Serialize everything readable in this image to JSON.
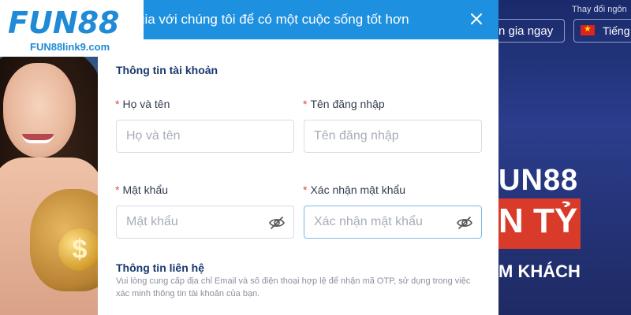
{
  "logo": {
    "brand": "FUN88",
    "domain": "FUN88link9.com"
  },
  "background": {
    "language_label": "Thay đổi ngôn",
    "join_button": "n gia ngay",
    "language_button": "Tiếng",
    "promo_brand": "UN88",
    "promo_amount": "N TỶ",
    "promo_sub": "M KHÁCH",
    "coin_symbol": "$"
  },
  "modal": {
    "title": "gia với chúng tôi để có một cuộc sống tốt hơn",
    "close_icon": "close-icon",
    "account_section": "Thông tin tài khoản",
    "contact_section": "Thông tin liên hệ",
    "contact_description": "Vui lòng cung cấp địa chỉ Email và số điện thoại hợp lệ để nhận mã OTP, sử dụng trong việc xác minh thông tin tài khoản của bạn.",
    "required_mark": "*",
    "fields": {
      "full_name": {
        "label": "Họ và tên",
        "placeholder": "Họ và tên"
      },
      "username": {
        "label": "Tên đăng nhập",
        "placeholder": "Tên đăng nhập"
      },
      "password": {
        "label": "Mật khẩu",
        "placeholder": "Mật khẩu",
        "icon": "eye-off-icon"
      },
      "confirm_password": {
        "label": "Xác nhận mật khẩu",
        "placeholder": "Xác nhận mật khẩu",
        "icon": "eye-off-icon"
      }
    }
  },
  "colors": {
    "header_blue": "#1e90e0",
    "section_title": "#18386b",
    "required": "#e6453a",
    "focus_border": "#7fb8e6"
  }
}
